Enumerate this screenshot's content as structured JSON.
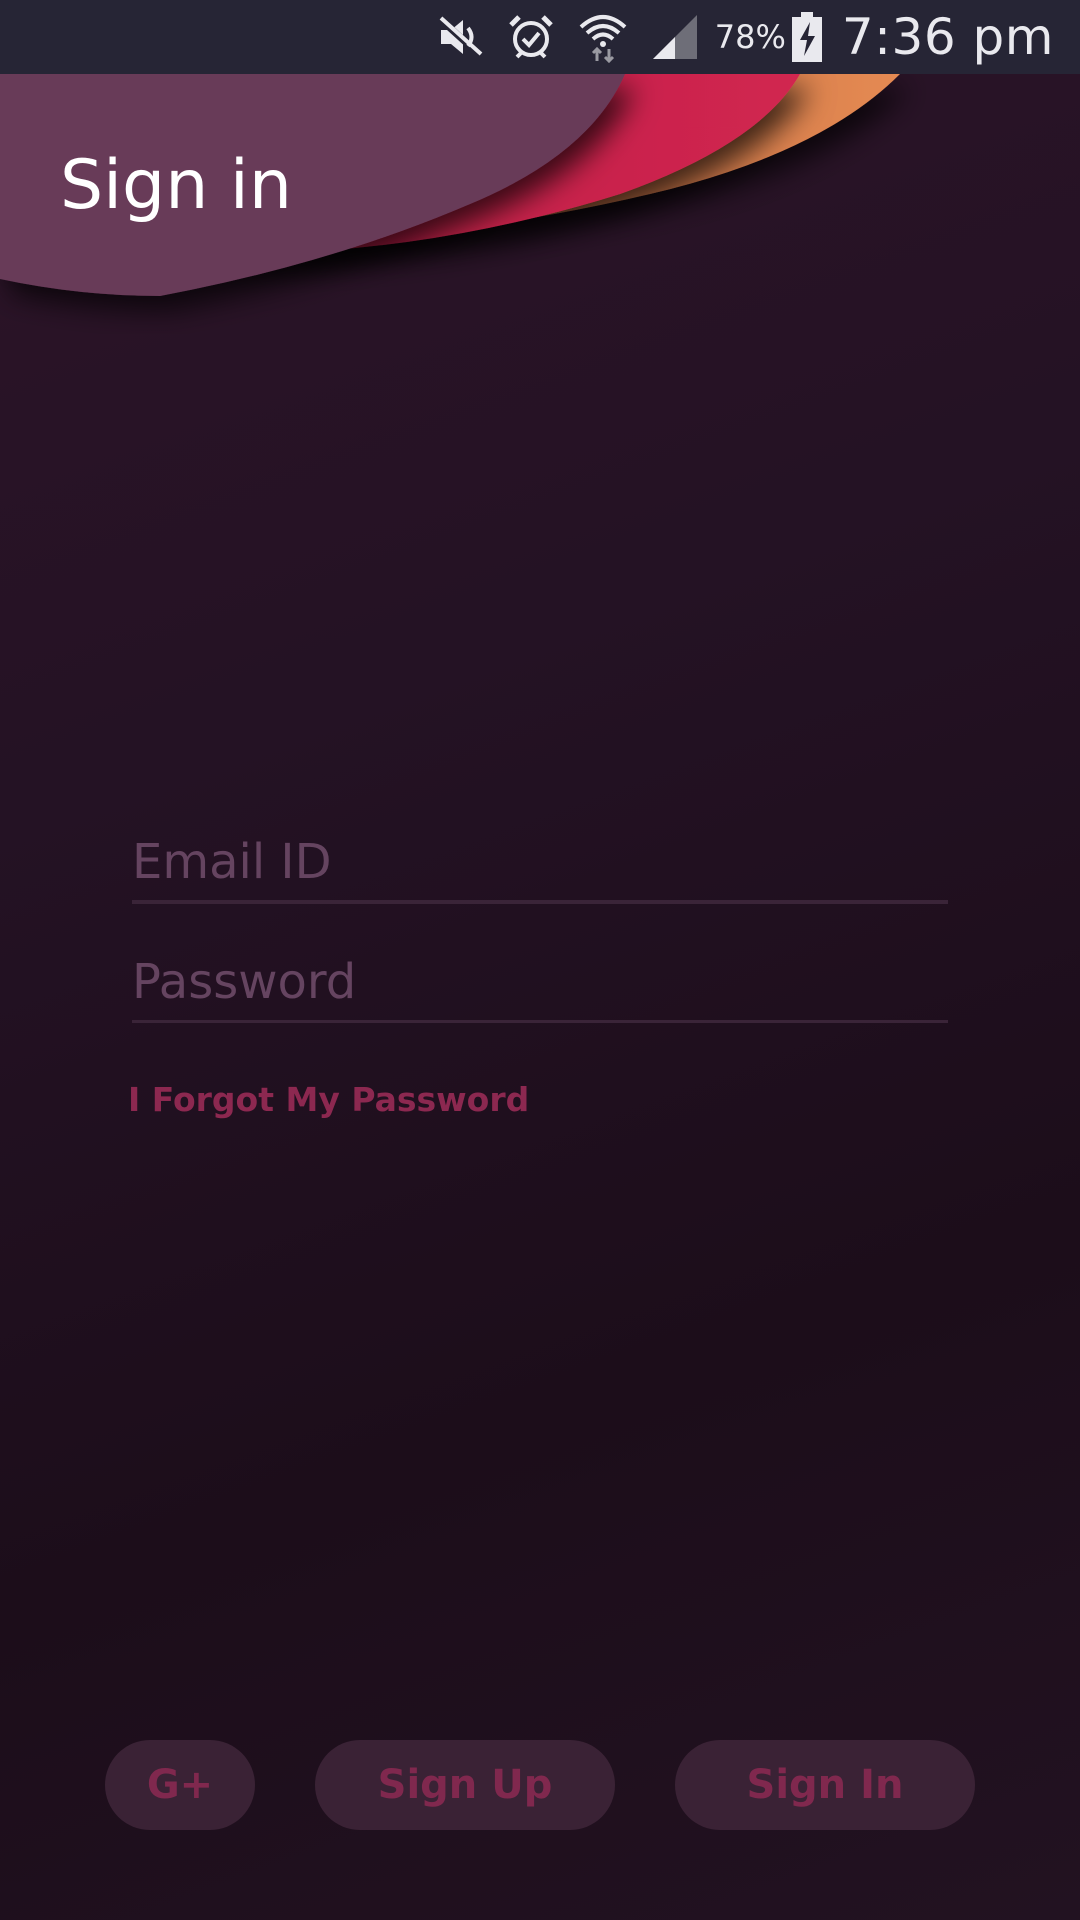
{
  "status_bar": {
    "battery_percent": "78%",
    "time": "7:36 pm",
    "icons": [
      "mute-icon",
      "alarm-icon",
      "wifi-icon",
      "signal-icon",
      "battery-charging-icon"
    ]
  },
  "header": {
    "title": "Sign in"
  },
  "form": {
    "email_placeholder": "Email ID",
    "email_value": "",
    "password_placeholder": "Password",
    "password_value": "",
    "forgot_label": "I Forgot My Password"
  },
  "actions": {
    "google_label": "G+",
    "signup_label": "Sign Up",
    "signin_label": "Sign In"
  },
  "colors": {
    "status_bar_bg": "#262535",
    "background": "#1f1020",
    "header_band": "#673a58",
    "wave_red": "#c8214d",
    "wave_orange": "#e08050",
    "accent_text": "#8c2850",
    "placeholder": "#654460",
    "button_bg": "#3a2235"
  }
}
